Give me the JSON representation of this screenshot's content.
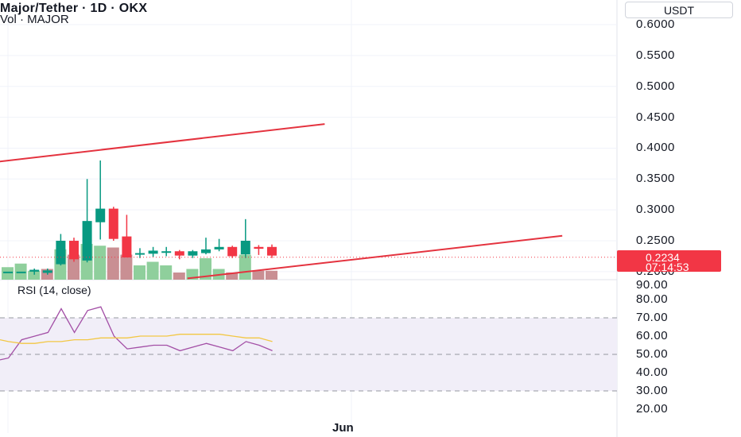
{
  "header": {
    "title": "Major/Tether · 1D · OKX",
    "volume_label": "Vol · MAJOR",
    "currency_button": "USDT"
  },
  "price_tag": {
    "price": "0.2234",
    "countdown": "07:14:53",
    "color": "#f23645"
  },
  "rsi": {
    "title": "RSI (14, close)"
  },
  "x_axis_label": "Jun",
  "chart_data": [
    {
      "type": "candlestick",
      "title": "Major/Tether · 1D · OKX",
      "ylim": [
        0.19,
        0.62
      ],
      "y_ticks": [
        "0.6000",
        "0.5500",
        "0.5000",
        "0.4500",
        "0.4000",
        "0.3500",
        "0.3000",
        "0.2500",
        "0.2000"
      ],
      "candles": [
        {
          "o": 0.2,
          "h": 0.2,
          "l": 0.2,
          "c": 0.2
        },
        {
          "o": 0.2,
          "h": 0.2,
          "l": 0.2,
          "c": 0.2
        },
        {
          "o": 0.2,
          "h": 0.205,
          "l": 0.195,
          "c": 0.203
        },
        {
          "o": 0.198,
          "h": 0.205,
          "l": 0.195,
          "c": 0.202
        },
        {
          "o": 0.212,
          "h": 0.261,
          "l": 0.21,
          "c": 0.25
        },
        {
          "o": 0.25,
          "h": 0.255,
          "l": 0.216,
          "c": 0.22
        },
        {
          "o": 0.218,
          "h": 0.35,
          "l": 0.215,
          "c": 0.282
        },
        {
          "o": 0.28,
          "h": 0.38,
          "l": 0.252,
          "c": 0.302
        },
        {
          "o": 0.302,
          "h": 0.305,
          "l": 0.25,
          "c": 0.253
        },
        {
          "o": 0.257,
          "h": 0.292,
          "l": 0.225,
          "c": 0.223
        },
        {
          "o": 0.228,
          "h": 0.238,
          "l": 0.222,
          "c": 0.23
        },
        {
          "o": 0.229,
          "h": 0.24,
          "l": 0.224,
          "c": 0.234
        },
        {
          "o": 0.232,
          "h": 0.24,
          "l": 0.225,
          "c": 0.233
        },
        {
          "o": 0.233,
          "h": 0.235,
          "l": 0.22,
          "c": 0.226
        },
        {
          "o": 0.226,
          "h": 0.235,
          "l": 0.222,
          "c": 0.233
        },
        {
          "o": 0.23,
          "h": 0.255,
          "l": 0.228,
          "c": 0.236
        },
        {
          "o": 0.236,
          "h": 0.253,
          "l": 0.233,
          "c": 0.24
        },
        {
          "o": 0.24,
          "h": 0.242,
          "l": 0.222,
          "c": 0.225
        },
        {
          "o": 0.228,
          "h": 0.285,
          "l": 0.222,
          "c": 0.25
        },
        {
          "o": 0.24,
          "h": 0.243,
          "l": 0.227,
          "c": 0.237
        },
        {
          "o": 0.24,
          "h": 0.244,
          "l": 0.222,
          "c": 0.226
        }
      ],
      "volumes": [
        0.35,
        0.45,
        0.25,
        0.3,
        0.85,
        0.7,
        1.0,
        0.95,
        0.9,
        0.7,
        0.4,
        0.5,
        0.4,
        0.2,
        0.3,
        0.6,
        0.3,
        0.2,
        0.7,
        0.25,
        0.25
      ],
      "volume_colors": [
        "up",
        "up",
        "up",
        "down",
        "up",
        "down",
        "up",
        "up",
        "down",
        "down",
        "up",
        "up",
        "up",
        "down",
        "up",
        "up",
        "up",
        "down",
        "up",
        "down",
        "down"
      ],
      "trendlines": [
        {
          "from": {
            "bar": -2,
            "price": 0.375
          },
          "to": {
            "bar": 24,
            "price": 0.439
          }
        },
        {
          "from": {
            "bar": 13.6,
            "price": 0.189
          },
          "to": {
            "bar": 42,
            "price": 0.258
          }
        }
      ],
      "current_price": 0.2234,
      "colors": {
        "up": "#089981",
        "down": "#f23645",
        "vol_up": "#8fcf9c",
        "vol_down": "#c98f93",
        "trend": "#e4333f"
      }
    },
    {
      "type": "line",
      "title": "RSI (14, close)",
      "ylim": [
        17,
        93
      ],
      "y_ticks": [
        "90.00",
        "80.00",
        "70.00",
        "60.00",
        "50.00",
        "40.00",
        "30.00",
        "20.00"
      ],
      "bands": {
        "upper": 70,
        "middle": 50,
        "lower": 30
      },
      "series": [
        {
          "values": [
            47,
            48,
            58,
            60,
            62,
            75,
            62,
            74,
            76,
            60,
            53,
            54,
            55,
            55,
            52,
            54,
            56,
            54,
            52,
            57,
            55,
            52
          ],
          "color": "#a34fa6"
        },
        {
          "values": [
            58,
            57,
            56,
            56,
            57,
            57,
            58,
            58,
            59,
            59,
            59,
            60,
            60,
            60,
            61,
            61,
            61,
            61,
            60,
            59,
            59,
            57
          ],
          "color": "#f2c744"
        }
      ]
    }
  ]
}
